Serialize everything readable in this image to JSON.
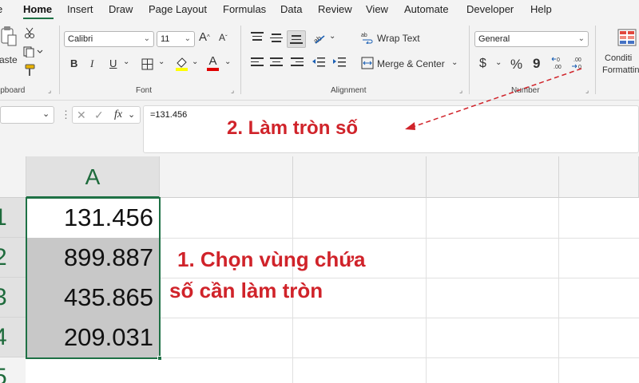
{
  "menu": {
    "tabs": [
      "e",
      "Home",
      "Insert",
      "Draw",
      "Page Layout",
      "Formulas",
      "Data",
      "Review",
      "View",
      "Automate",
      "Developer",
      "Help"
    ],
    "active": "Home"
  },
  "ribbon": {
    "clipboard": {
      "paste_label": "aste",
      "group_label": "ipboard"
    },
    "font": {
      "font_name": "Calibri",
      "font_size": "11",
      "group_label": "Font",
      "grow": "A",
      "shrink": "A",
      "bold": "B",
      "italic": "I",
      "underline": "U",
      "font_color": "A"
    },
    "alignment": {
      "wrap_text": "Wrap Text",
      "merge_center": "Merge & Center",
      "group_label": "Alignment"
    },
    "number": {
      "format": "General",
      "currency": "$",
      "percent": "%",
      "comma": "9",
      "group_label": "Number",
      "inc_decimal": "←0 .00",
      "dec_decimal": ".00 →0"
    },
    "styles": {
      "conditional_line1": "Conditi",
      "conditional_line2": "Formattin"
    }
  },
  "formula_bar": {
    "fx": "fx",
    "value": "=131.456"
  },
  "sheet": {
    "column_header": "A",
    "rows": [
      {
        "num": "1",
        "value": "131.456"
      },
      {
        "num": "2",
        "value": "899.887"
      },
      {
        "num": "3",
        "value": "435.865"
      },
      {
        "num": "4",
        "value": "209.031"
      },
      {
        "num": "5",
        "value": ""
      }
    ]
  },
  "annotations": {
    "step2": "2. Làm tròn số",
    "step1_line1": "1. Chọn vùng chứa",
    "step1_line2": "số cần làm tròn"
  },
  "colors": {
    "excel_green": "#1e7145",
    "annotation_red": "#d0232a",
    "selection": "#c8c8c8"
  }
}
